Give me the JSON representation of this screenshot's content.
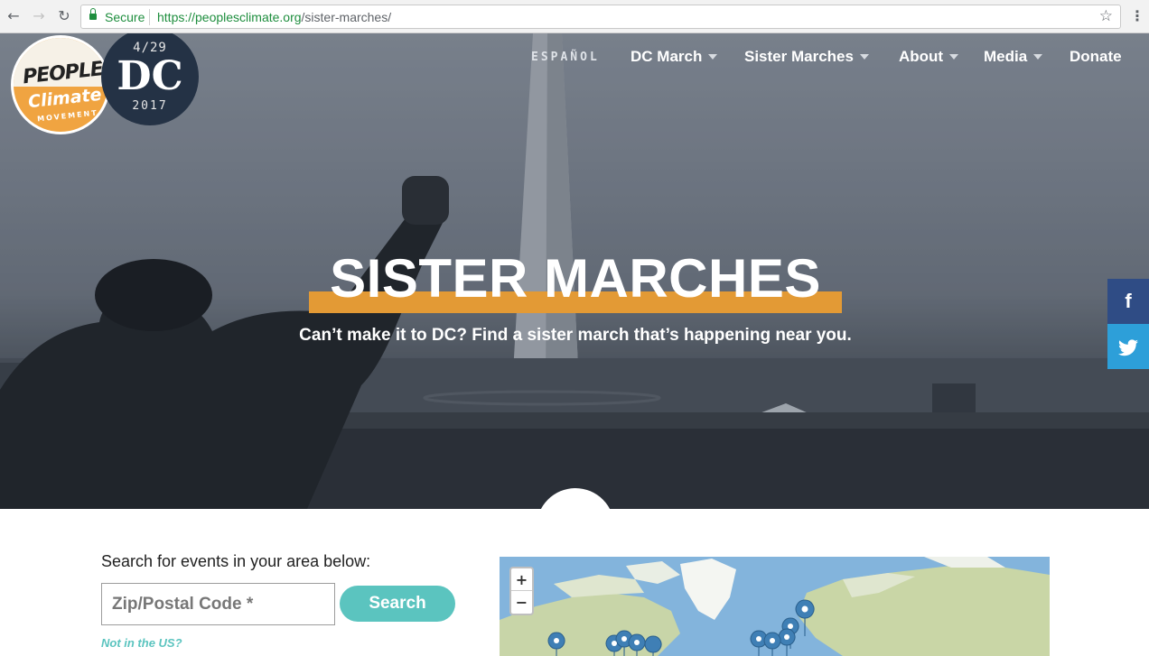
{
  "browser": {
    "secure_label": "Secure",
    "url_host": "https://peoplesclimate.org",
    "url_path": "/sister-marches/"
  },
  "logo": {
    "line1": "PEOPLES",
    "line2": "Climate",
    "line3": "MOVEMENT",
    "event_date": "4/29",
    "event_city": "DC",
    "event_year": "2017"
  },
  "nav": {
    "espanol": "ESPAÑOL",
    "dc_march": "DC March",
    "sister_marches": "Sister Marches",
    "about": "About",
    "media": "Media",
    "donate": "Donate"
  },
  "hero": {
    "title": "SISTER MARCHES",
    "subtitle": "Can’t make it to DC? Find a sister march that’s happening near you.",
    "accent_color": "#e39a35"
  },
  "share": {
    "facebook_glyph": "f",
    "twitter_icon": "twitter-bird-icon"
  },
  "search": {
    "label": "Search for events in your area below:",
    "zip_placeholder": "Zip/Postal Code *",
    "button_label": "Search",
    "not_us_link": "Not in the US?",
    "button_color": "#5bc4bf"
  },
  "map": {
    "zoom_in": "+",
    "zoom_out": "−"
  }
}
